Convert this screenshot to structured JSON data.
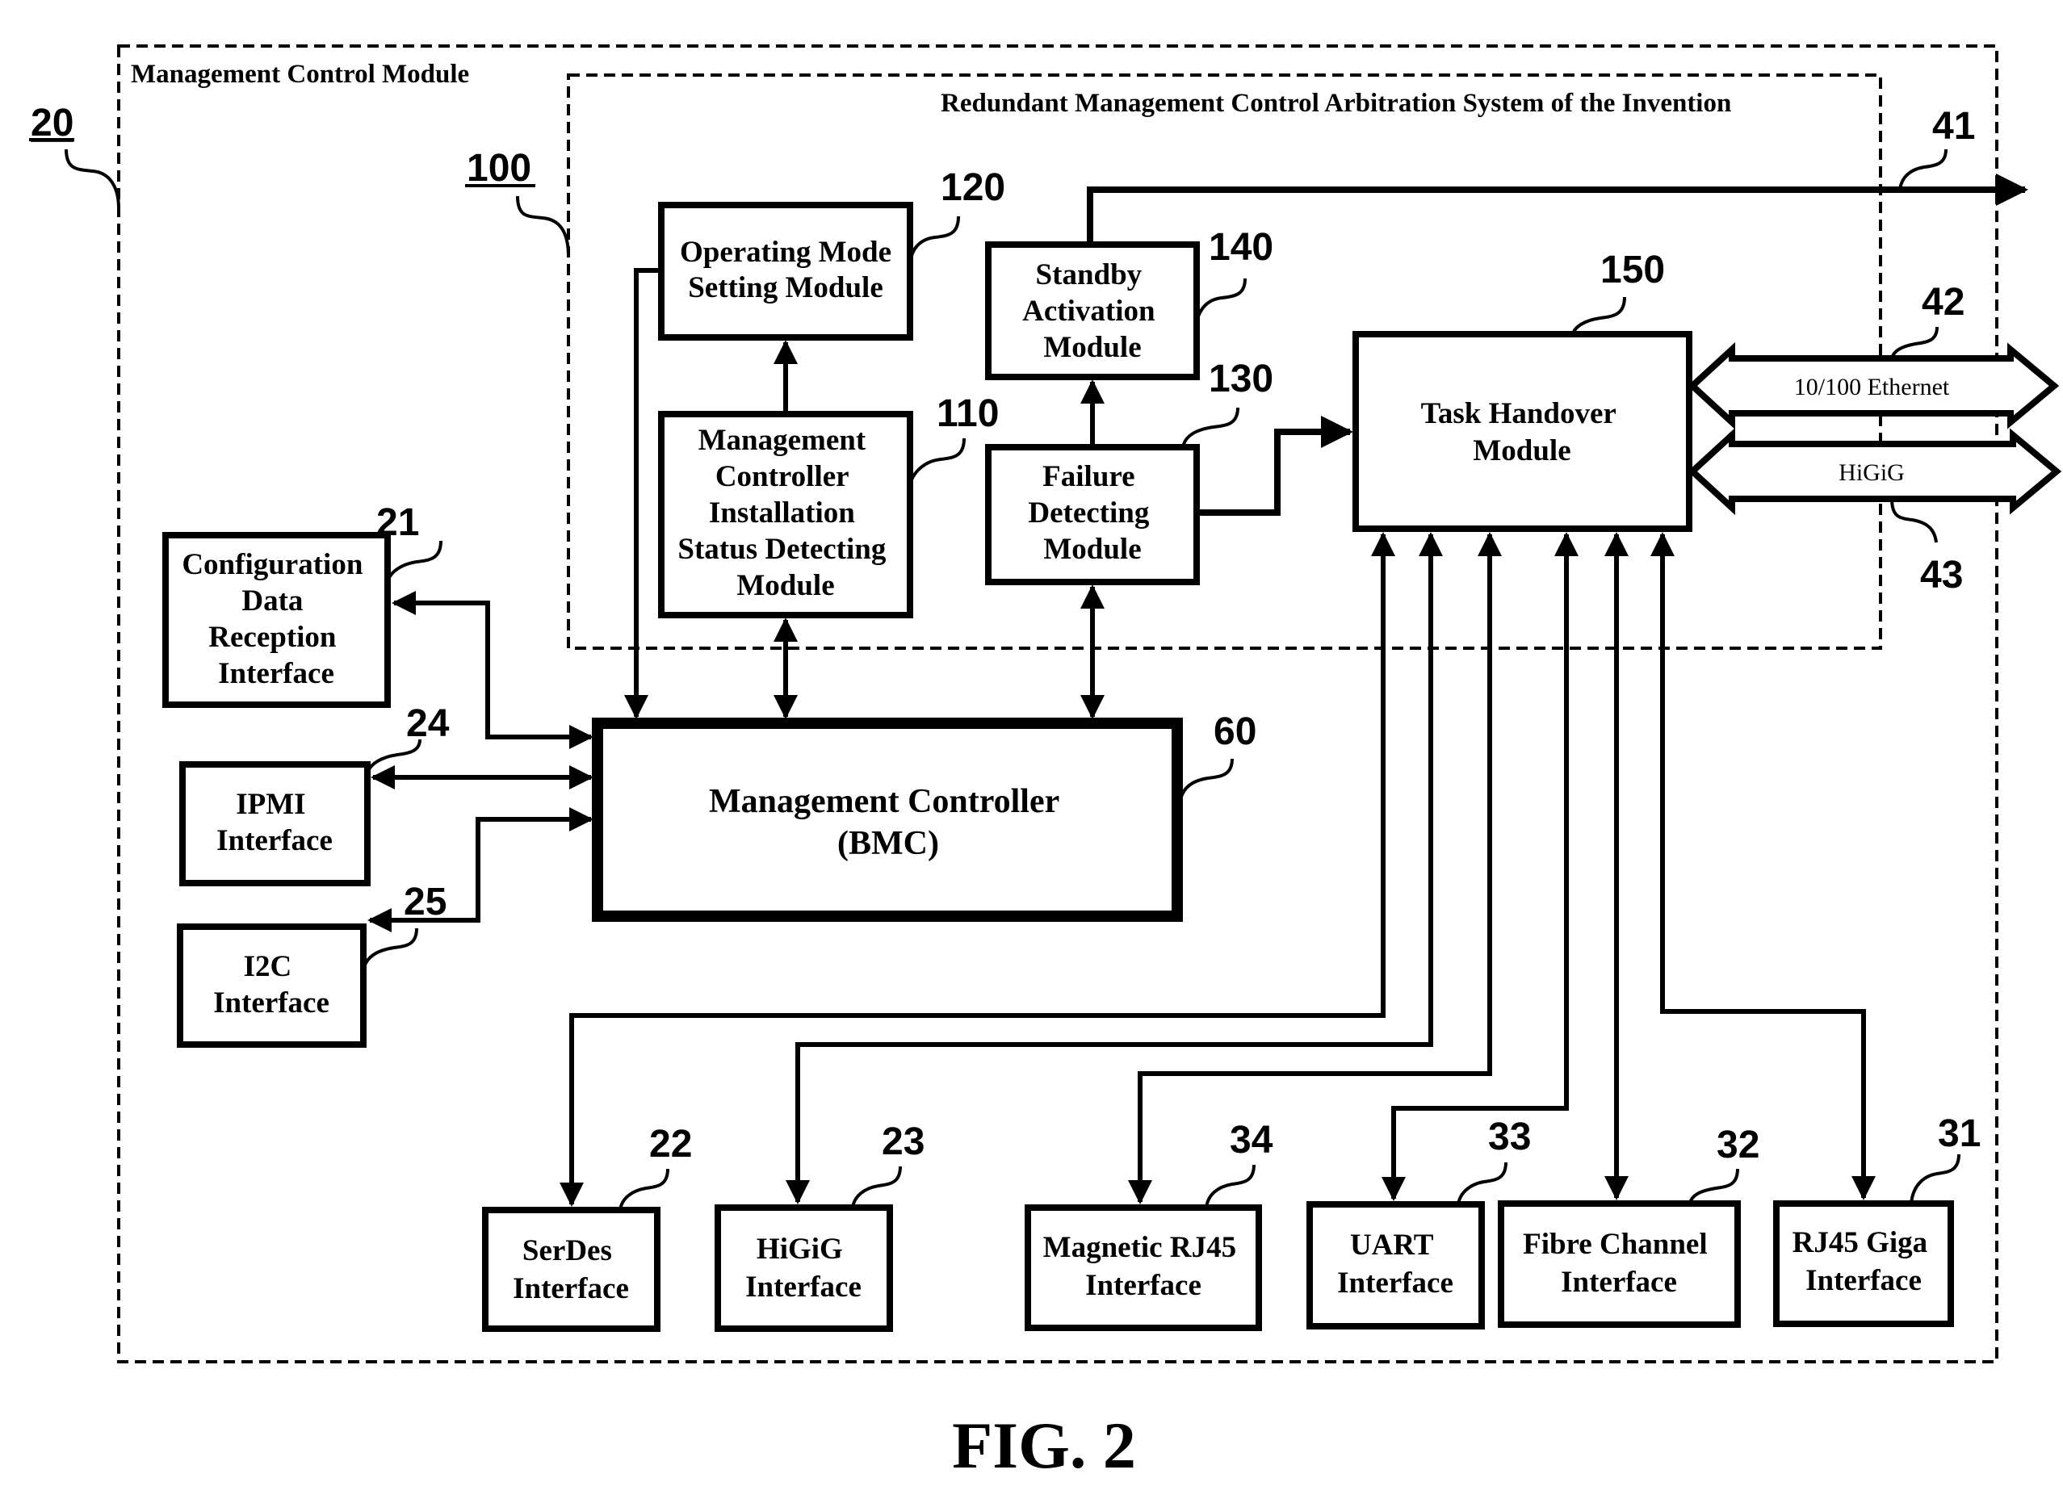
{
  "figure": {
    "caption": "FIG. 2"
  },
  "regions": {
    "outer": {
      "title": "Management Control Module",
      "ref": "20"
    },
    "inner": {
      "title": "Redundant Management Control Arbitration System of the Invention",
      "ref": "100"
    }
  },
  "modules": {
    "m120": {
      "ref": "120",
      "lines": [
        "Operating Mode",
        "Setting Module"
      ]
    },
    "m110": {
      "ref": "110",
      "lines": [
        "Management",
        "Controller",
        "Installation",
        "Status Detecting",
        "Module"
      ]
    },
    "m140": {
      "ref": "140",
      "lines": [
        "Standby",
        "Activation",
        "Module"
      ]
    },
    "m130": {
      "ref": "130",
      "lines": [
        "Failure",
        "Detecting",
        "Module"
      ]
    },
    "m150": {
      "ref": "150",
      "lines": [
        "Task Handover",
        "Module"
      ]
    },
    "m60": {
      "ref": "60",
      "lines": [
        "Management Controller",
        "(BMC)"
      ]
    }
  },
  "interfaces": {
    "i21": {
      "ref": "21",
      "lines": [
        "Configuration",
        "Data",
        "Reception",
        "Interface"
      ]
    },
    "i24": {
      "ref": "24",
      "lines": [
        "IPMI",
        "Interface"
      ]
    },
    "i25": {
      "ref": "25",
      "lines": [
        "I2C",
        "Interface"
      ]
    },
    "i22": {
      "ref": "22",
      "lines": [
        "SerDes",
        "Interface"
      ]
    },
    "i23": {
      "ref": "23",
      "lines": [
        "HiGiG",
        "Interface"
      ]
    },
    "i34": {
      "ref": "34",
      "lines": [
        "Magnetic RJ45",
        "Interface"
      ]
    },
    "i33": {
      "ref": "33",
      "lines": [
        "UART",
        "Interface"
      ]
    },
    "i32": {
      "ref": "32",
      "lines": [
        "Fibre Channel",
        "Interface"
      ]
    },
    "i31": {
      "ref": "31",
      "lines": [
        "RJ45 Giga",
        "Interface"
      ]
    }
  },
  "buses": {
    "b41": {
      "ref": "41",
      "label": ""
    },
    "b42": {
      "ref": "42",
      "label": "10/100 Ethernet"
    },
    "b43": {
      "ref": "43",
      "label": "HiGiG"
    }
  }
}
